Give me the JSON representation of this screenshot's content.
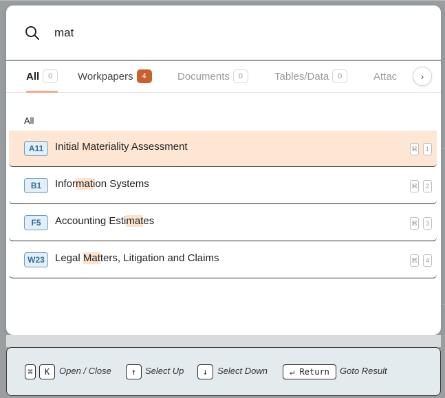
{
  "search": {
    "value": "mat",
    "placeholder": ""
  },
  "tabs": [
    {
      "label": "All",
      "count": "0"
    },
    {
      "label": "Workpapers",
      "count": "4"
    },
    {
      "label": "Documents",
      "count": "0"
    },
    {
      "label": "Tables/Data",
      "count": "0"
    },
    {
      "label": "Attac"
    }
  ],
  "tab_next_glyph": "›",
  "section_label": "All",
  "results": [
    {
      "code": "A11",
      "pre": "Initial ",
      "match": "Ma",
      "post": "teriality Assessment",
      "mod": "⌘",
      "key": "1"
    },
    {
      "code": "B1",
      "pre": "Infor",
      "match": "mat",
      "post": "ion Systems",
      "mod": "⌘",
      "key": "2"
    },
    {
      "code": "F5",
      "pre": "Accounting Esti",
      "match": "mat",
      "post": "es",
      "mod": "⌘",
      "key": "3"
    },
    {
      "code": "W23",
      "pre": "Legal ",
      "match": "Mat",
      "post": "ters, Litigation and Claims",
      "mod": "⌘",
      "key": "4"
    }
  ],
  "footer": {
    "open_close_mod": "⌘",
    "open_close_key": "K",
    "open_close_label": "Open / Close",
    "select_up_key": "↑",
    "select_up_label": "Select Up",
    "select_down_key": "↓",
    "select_down_label": "Select Down",
    "return_key": "↵ Return",
    "goto_label": "Goto Result"
  },
  "colors": {
    "accent": "#c9602d",
    "selected_row": "#fde6d4",
    "match_highlight": "#fde3cc",
    "code_badge_text": "#2f6e9b",
    "footer_bg": "#e3ebee"
  }
}
